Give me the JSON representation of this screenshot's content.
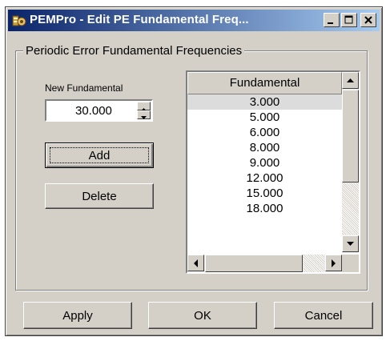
{
  "window": {
    "title": "PEMPro - Edit PE Fundamental Freq..."
  },
  "title_buttons": {
    "minimize_icon": "minimize-icon",
    "maximize_icon": "maximize-icon",
    "close_icon": "close-icon"
  },
  "group": {
    "label": "Periodic Error Fundamental Frequencies"
  },
  "new_fundamental": {
    "label": "New Fundamental",
    "value": "30.000"
  },
  "buttons": {
    "add": "Add",
    "delete": "Delete",
    "apply": "Apply",
    "ok": "OK",
    "cancel": "Cancel"
  },
  "list": {
    "header": "Fundamental",
    "rows": [
      "3.000",
      "5.000",
      "6.000",
      "8.000",
      "9.000",
      "12.000",
      "15.000",
      "18.000"
    ],
    "selected_index": 0
  },
  "colors": {
    "titlebar_start": "#0a246a",
    "titlebar_end": "#a6caf0",
    "face": "#d4d0c8"
  }
}
